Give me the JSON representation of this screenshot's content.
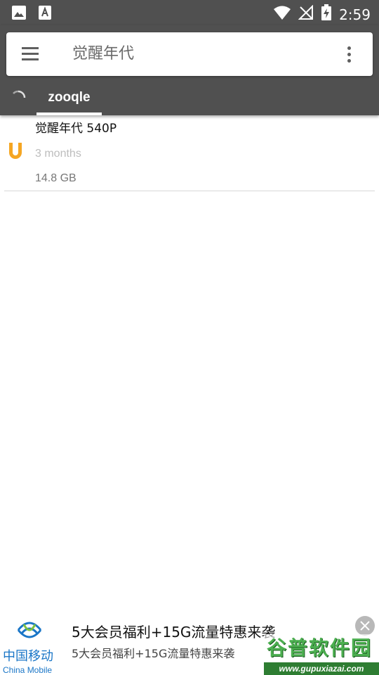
{
  "status_bar": {
    "time": "2:59",
    "icons": [
      "image-icon",
      "text-app-icon",
      "wifi-icon",
      "no-signal-icon",
      "battery-charging-icon"
    ]
  },
  "search": {
    "query": "觉醒年代"
  },
  "tabs": [
    {
      "label": "zooqle",
      "selected": true
    }
  ],
  "results": [
    {
      "title": "觉醒年代 540P",
      "age": "3 months",
      "size": "14.8 GB",
      "icon": "magnet-icon"
    }
  ],
  "ad": {
    "brand_cn": "中国移动",
    "brand_en": "China Mobile",
    "title": "5大会员福利+15G流量特惠来袭",
    "subtitle": "5大会员福利+15G流量特惠来袭"
  },
  "watermark": {
    "text": "谷普软件园",
    "url": "www.gupuxiazai.com"
  },
  "colors": {
    "header_bg": "#505050",
    "magnet_orange": "#f5a623",
    "brand_blue": "#1a76c7"
  }
}
